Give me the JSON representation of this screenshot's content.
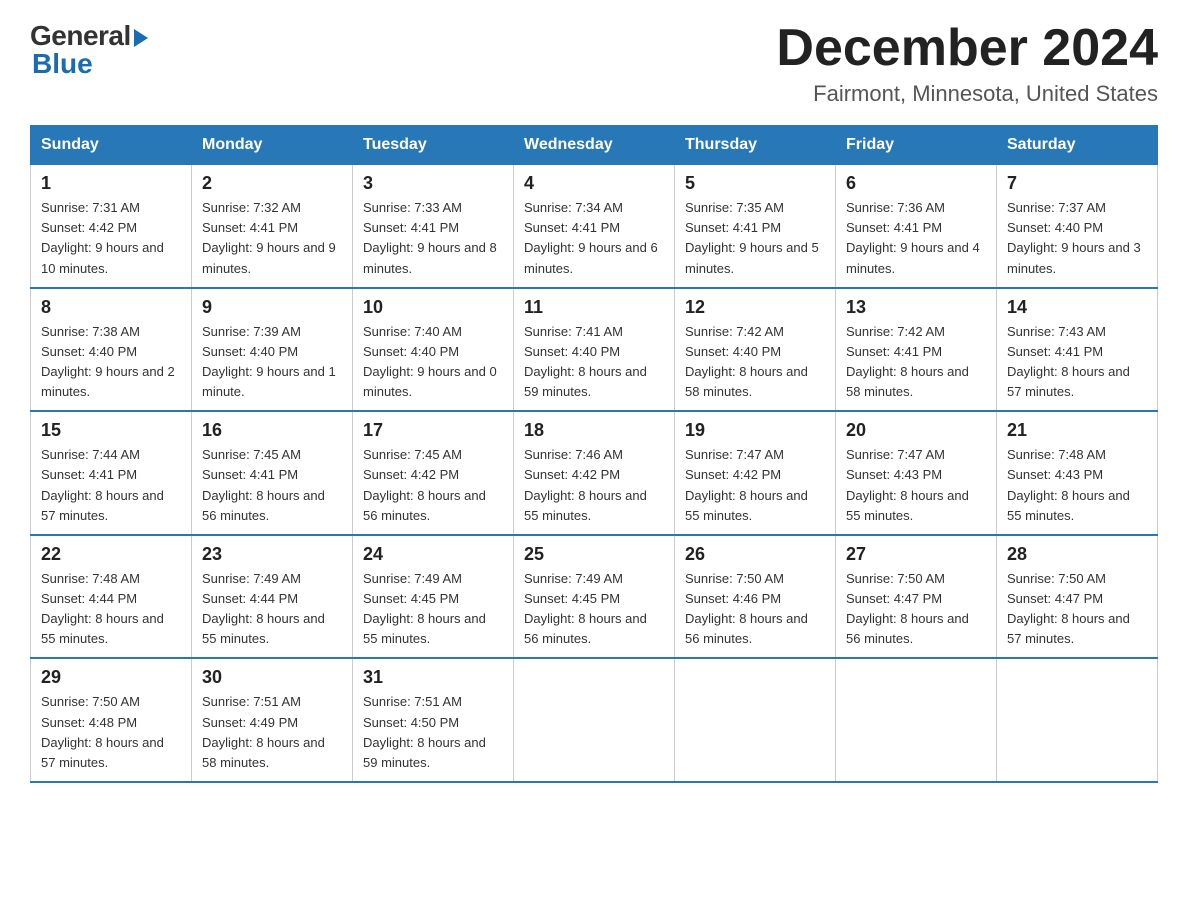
{
  "logo": {
    "general": "General",
    "blue": "Blue"
  },
  "header": {
    "month": "December 2024",
    "location": "Fairmont, Minnesota, United States"
  },
  "weekdays": [
    "Sunday",
    "Monday",
    "Tuesday",
    "Wednesday",
    "Thursday",
    "Friday",
    "Saturday"
  ],
  "weeks": [
    [
      {
        "day": "1",
        "sunrise": "7:31 AM",
        "sunset": "4:42 PM",
        "daylight": "9 hours and 10 minutes."
      },
      {
        "day": "2",
        "sunrise": "7:32 AM",
        "sunset": "4:41 PM",
        "daylight": "9 hours and 9 minutes."
      },
      {
        "day": "3",
        "sunrise": "7:33 AM",
        "sunset": "4:41 PM",
        "daylight": "9 hours and 8 minutes."
      },
      {
        "day": "4",
        "sunrise": "7:34 AM",
        "sunset": "4:41 PM",
        "daylight": "9 hours and 6 minutes."
      },
      {
        "day": "5",
        "sunrise": "7:35 AM",
        "sunset": "4:41 PM",
        "daylight": "9 hours and 5 minutes."
      },
      {
        "day": "6",
        "sunrise": "7:36 AM",
        "sunset": "4:41 PM",
        "daylight": "9 hours and 4 minutes."
      },
      {
        "day": "7",
        "sunrise": "7:37 AM",
        "sunset": "4:40 PM",
        "daylight": "9 hours and 3 minutes."
      }
    ],
    [
      {
        "day": "8",
        "sunrise": "7:38 AM",
        "sunset": "4:40 PM",
        "daylight": "9 hours and 2 minutes."
      },
      {
        "day": "9",
        "sunrise": "7:39 AM",
        "sunset": "4:40 PM",
        "daylight": "9 hours and 1 minute."
      },
      {
        "day": "10",
        "sunrise": "7:40 AM",
        "sunset": "4:40 PM",
        "daylight": "9 hours and 0 minutes."
      },
      {
        "day": "11",
        "sunrise": "7:41 AM",
        "sunset": "4:40 PM",
        "daylight": "8 hours and 59 minutes."
      },
      {
        "day": "12",
        "sunrise": "7:42 AM",
        "sunset": "4:40 PM",
        "daylight": "8 hours and 58 minutes."
      },
      {
        "day": "13",
        "sunrise": "7:42 AM",
        "sunset": "4:41 PM",
        "daylight": "8 hours and 58 minutes."
      },
      {
        "day": "14",
        "sunrise": "7:43 AM",
        "sunset": "4:41 PM",
        "daylight": "8 hours and 57 minutes."
      }
    ],
    [
      {
        "day": "15",
        "sunrise": "7:44 AM",
        "sunset": "4:41 PM",
        "daylight": "8 hours and 57 minutes."
      },
      {
        "day": "16",
        "sunrise": "7:45 AM",
        "sunset": "4:41 PM",
        "daylight": "8 hours and 56 minutes."
      },
      {
        "day": "17",
        "sunrise": "7:45 AM",
        "sunset": "4:42 PM",
        "daylight": "8 hours and 56 minutes."
      },
      {
        "day": "18",
        "sunrise": "7:46 AM",
        "sunset": "4:42 PM",
        "daylight": "8 hours and 55 minutes."
      },
      {
        "day": "19",
        "sunrise": "7:47 AM",
        "sunset": "4:42 PM",
        "daylight": "8 hours and 55 minutes."
      },
      {
        "day": "20",
        "sunrise": "7:47 AM",
        "sunset": "4:43 PM",
        "daylight": "8 hours and 55 minutes."
      },
      {
        "day": "21",
        "sunrise": "7:48 AM",
        "sunset": "4:43 PM",
        "daylight": "8 hours and 55 minutes."
      }
    ],
    [
      {
        "day": "22",
        "sunrise": "7:48 AM",
        "sunset": "4:44 PM",
        "daylight": "8 hours and 55 minutes."
      },
      {
        "day": "23",
        "sunrise": "7:49 AM",
        "sunset": "4:44 PM",
        "daylight": "8 hours and 55 minutes."
      },
      {
        "day": "24",
        "sunrise": "7:49 AM",
        "sunset": "4:45 PM",
        "daylight": "8 hours and 55 minutes."
      },
      {
        "day": "25",
        "sunrise": "7:49 AM",
        "sunset": "4:45 PM",
        "daylight": "8 hours and 56 minutes."
      },
      {
        "day": "26",
        "sunrise": "7:50 AM",
        "sunset": "4:46 PM",
        "daylight": "8 hours and 56 minutes."
      },
      {
        "day": "27",
        "sunrise": "7:50 AM",
        "sunset": "4:47 PM",
        "daylight": "8 hours and 56 minutes."
      },
      {
        "day": "28",
        "sunrise": "7:50 AM",
        "sunset": "4:47 PM",
        "daylight": "8 hours and 57 minutes."
      }
    ],
    [
      {
        "day": "29",
        "sunrise": "7:50 AM",
        "sunset": "4:48 PM",
        "daylight": "8 hours and 57 minutes."
      },
      {
        "day": "30",
        "sunrise": "7:51 AM",
        "sunset": "4:49 PM",
        "daylight": "8 hours and 58 minutes."
      },
      {
        "day": "31",
        "sunrise": "7:51 AM",
        "sunset": "4:50 PM",
        "daylight": "8 hours and 59 minutes."
      },
      null,
      null,
      null,
      null
    ]
  ],
  "labels": {
    "sunrise": "Sunrise:",
    "sunset": "Sunset:",
    "daylight": "Daylight:"
  }
}
